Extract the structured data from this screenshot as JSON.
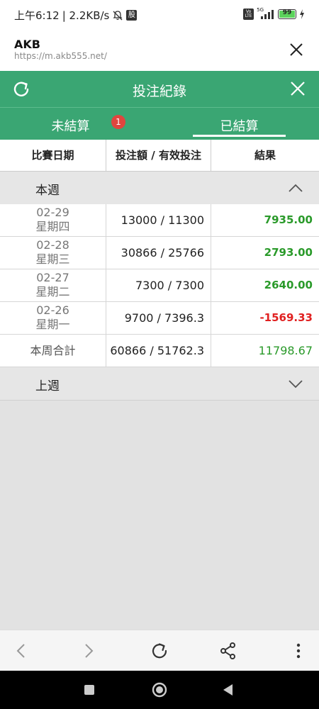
{
  "status_bar": {
    "time": "上午6:12",
    "speed": "| 2.2KB/s",
    "sim_badge": "股",
    "volte": "Vo LTE",
    "network": "5G",
    "battery": "99"
  },
  "browser": {
    "site_title": "AKB",
    "url": "https://m.akb555.net/"
  },
  "header": {
    "title": "投注紀錄"
  },
  "tabs": [
    {
      "label": "未結算",
      "badge": "1"
    },
    {
      "label": "已結算",
      "active": true
    }
  ],
  "columns": [
    "比賽日期",
    "投注額 / 有效投注",
    "結果"
  ],
  "groups": [
    {
      "label": "本週",
      "expanded": true
    },
    {
      "label": "上週",
      "expanded": false
    }
  ],
  "rows": [
    {
      "date": "02-29",
      "weekday": "星期四",
      "amount": "13000 / 11300",
      "result": "7935.00",
      "status": "positive"
    },
    {
      "date": "02-28",
      "weekday": "星期三",
      "amount": "30866 / 25766",
      "result": "2793.00",
      "status": "positive"
    },
    {
      "date": "02-27",
      "weekday": "星期二",
      "amount": "7300 / 7300",
      "result": "2640.00",
      "status": "positive"
    },
    {
      "date": "02-26",
      "weekday": "星期一",
      "amount": "9700 / 7396.3",
      "result": "-1569.33",
      "status": "negative"
    }
  ],
  "total": {
    "label": "本周合計",
    "amount": "60866 / 51762.3",
    "result": "11798.67"
  },
  "colors": {
    "header": "#3aa673",
    "positive": "#2a9a2a",
    "negative": "#e02020",
    "badge": "#e0453e"
  },
  "icons": {
    "close": "close-icon",
    "refresh": "refresh-icon",
    "chevron_up": "chevron-up-icon",
    "chevron_down": "chevron-down-icon",
    "back": "back-icon",
    "forward": "forward-icon",
    "reload": "reload-icon",
    "share": "share-icon",
    "menu": "more-vert-icon"
  }
}
